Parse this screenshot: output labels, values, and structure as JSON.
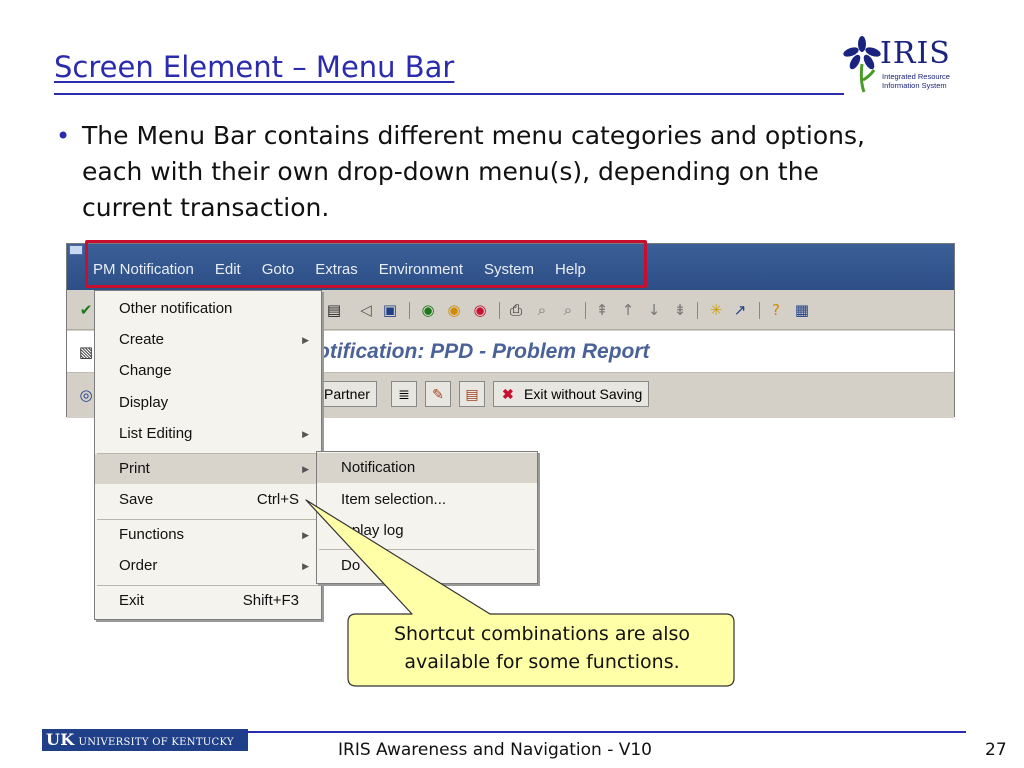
{
  "slide": {
    "title": "Screen Element – Menu Bar",
    "bullet": "The Menu Bar contains different menu categories and options, each with their own drop-down menu(s), depending on the current transaction.",
    "logo": {
      "word": "IRIS",
      "sub1": "Integrated Resource",
      "sub2": "Information System"
    }
  },
  "menubar": {
    "items": [
      "PM Notification",
      "Edit",
      "Goto",
      "Extras",
      "Environment",
      "System",
      "Help"
    ]
  },
  "toolbar": {
    "icons": [
      "check-icon",
      "back-arrow-icon",
      "save-icon",
      "back-icon",
      "exit-icon",
      "cancel-icon",
      "print-icon",
      "find-icon",
      "find-next-icon",
      "first-page-icon",
      "prev-page-icon",
      "next-page-icon",
      "last-page-icon",
      "new-session-icon",
      "shortcut-icon",
      "help-icon",
      "layout-icon"
    ]
  },
  "screen": {
    "title": "otification: PPD - Problem Report",
    "buttons": {
      "partner": "Partner",
      "exit": "Exit without Saving"
    }
  },
  "menu_main": {
    "items": [
      {
        "label": "Other notification"
      },
      {
        "label": "Create",
        "submenu": true
      },
      {
        "label": "Change"
      },
      {
        "label": "Display"
      },
      {
        "label": "List Editing",
        "submenu": true
      },
      {
        "label": "Print",
        "submenu": true,
        "selected": true
      },
      {
        "label": "Save",
        "shortcut": "Ctrl+S"
      },
      {
        "label": "Functions",
        "submenu": true
      },
      {
        "label": "Order",
        "submenu": true
      },
      {
        "label": "Exit",
        "shortcut": "Shift+F3"
      }
    ]
  },
  "menu_print": {
    "items": [
      {
        "label": "Notification",
        "selected": true
      },
      {
        "label": "Item selection..."
      },
      {
        "label": "isplay log"
      },
      {
        "label": "Do"
      }
    ]
  },
  "callout": {
    "line1": "Shortcut combinations are also",
    "line2": "available for some functions."
  },
  "footer": {
    "uk_mark": "UK",
    "uk_text": "UNIVERSITY OF KENTUCKY",
    "center": "IRIS Awareness and Navigation - V10",
    "page": "27"
  }
}
